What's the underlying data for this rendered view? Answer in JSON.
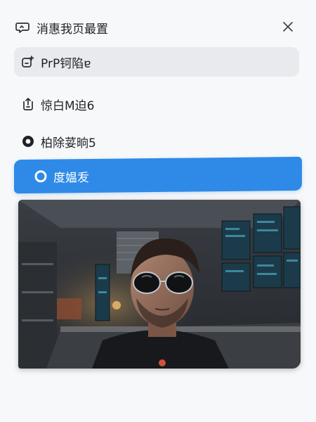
{
  "header": {
    "title": "消惠我页最置",
    "title_icon": "chat-bubble-icon",
    "close_icon": "close-icon"
  },
  "menu": [
    {
      "label": "PrP钶陷ɐ",
      "icon": "media-upload-icon",
      "state": "hover"
    },
    {
      "label": "惊白M迫6",
      "icon": "upload-tray-icon",
      "state": "normal"
    },
    {
      "label": "柏除荽晌5",
      "icon": "circle-dot-icon",
      "state": "normal"
    },
    {
      "label": "度媪叐",
      "icon": "ring-icon",
      "state": "selected"
    }
  ],
  "colors": {
    "accent": "#2e8ae6",
    "hover_bg": "#e9eaee",
    "text": "#1f2328",
    "panel_bg": "#f7f8fa"
  },
  "preview": {
    "type": "camera-preview-photo"
  }
}
